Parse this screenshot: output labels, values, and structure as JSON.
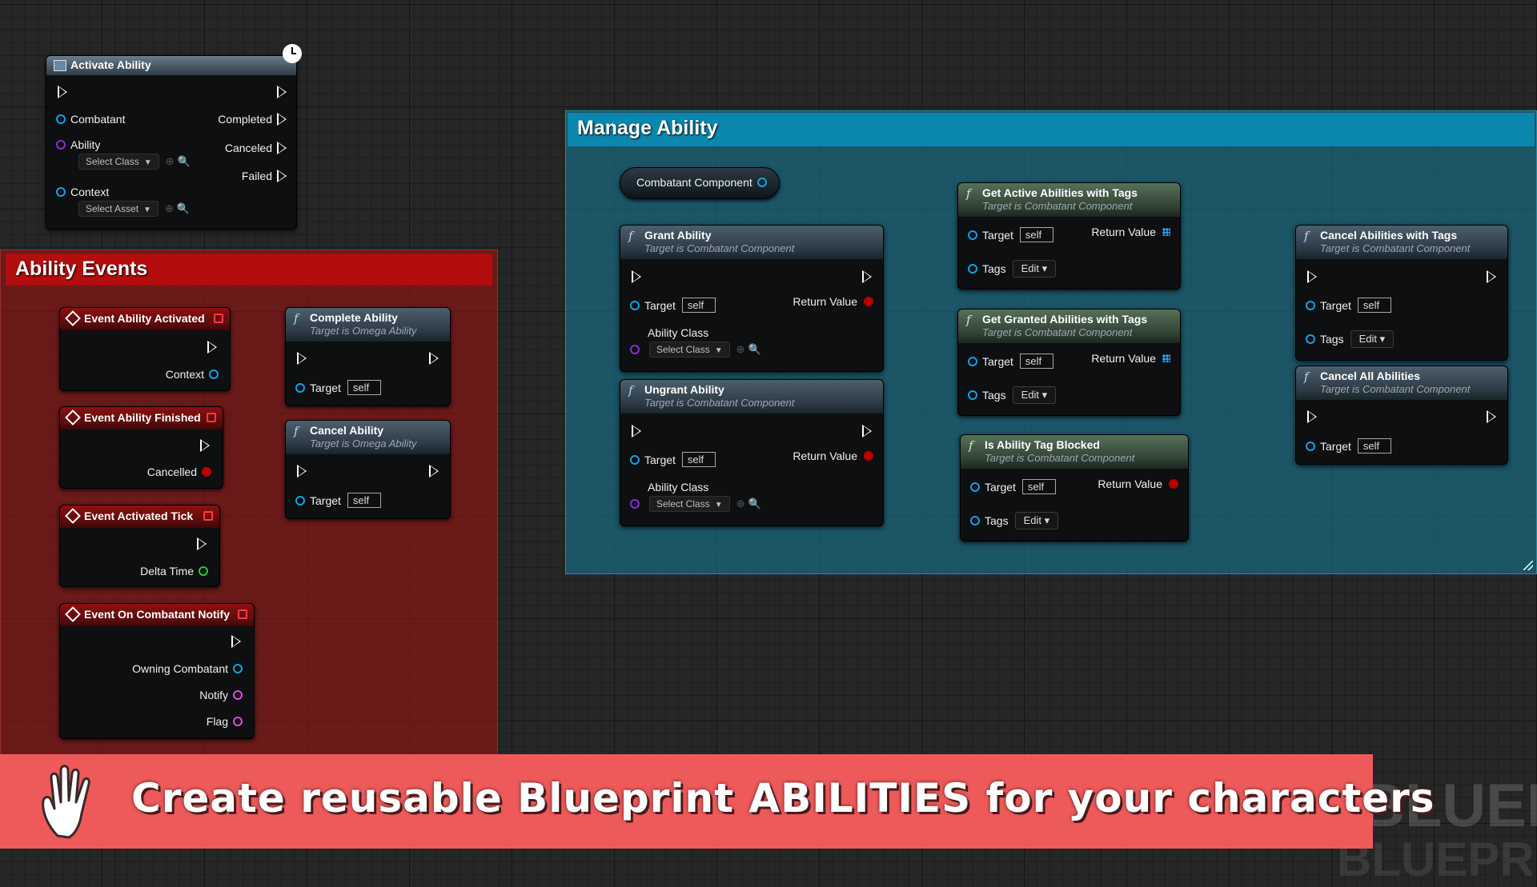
{
  "comments": {
    "ability_events": "Ability Events",
    "manage_ability": "Manage Ability"
  },
  "activate_ability": {
    "title": "Activate Ability",
    "combatant": "Combatant",
    "completed": "Completed",
    "ability": "Ability",
    "canceled": "Canceled",
    "select_class": "Select Class",
    "failed": "Failed",
    "context": "Context",
    "select_asset": "Select Asset"
  },
  "events": [
    {
      "title": "Event Ability Activated",
      "pins": [
        "Context"
      ]
    },
    {
      "title": "Event Ability Finished",
      "pins": [
        "Cancelled"
      ]
    },
    {
      "title": "Event Activated Tick",
      "pins": [
        "Delta Time"
      ]
    },
    {
      "title": "Event On Combatant Notify",
      "pins": [
        "Owning Combatant",
        "Notify",
        "Flag"
      ]
    }
  ],
  "omega_nodes": [
    {
      "title": "Complete Ability",
      "subtitle": "Target is Omega Ability",
      "target": "Target",
      "self": "self"
    },
    {
      "title": "Cancel Ability",
      "subtitle": "Target is Omega Ability",
      "target": "Target",
      "self": "self"
    }
  ],
  "combatant_component": "Combatant Component",
  "manage_nodes": {
    "grant": {
      "title": "Grant Ability",
      "subtitle": "Target is Combatant Component",
      "target": "Target",
      "self": "self",
      "return": "Return Value",
      "ability_class": "Ability Class",
      "select_class": "Select Class"
    },
    "ungrant": {
      "title": "Ungrant Ability",
      "subtitle": "Target is Combatant Component",
      "target": "Target",
      "self": "self",
      "return": "Return Value",
      "ability_class": "Ability Class",
      "select_class": "Select Class"
    },
    "get_active": {
      "title": "Get Active Abilities with Tags",
      "subtitle": "Target is Combatant Component",
      "target": "Target",
      "self": "self",
      "return": "Return Value",
      "tags": "Tags",
      "edit": "Edit"
    },
    "get_granted": {
      "title": "Get Granted Abilities with Tags",
      "subtitle": "Target is Combatant Component",
      "target": "Target",
      "self": "self",
      "return": "Return Value",
      "tags": "Tags",
      "edit": "Edit"
    },
    "is_blocked": {
      "title": "Is Ability Tag Blocked",
      "subtitle": "Target is Combatant Component",
      "target": "Target",
      "self": "self",
      "return": "Return Value",
      "tags": "Tags",
      "edit": "Edit"
    },
    "cancel_tags": {
      "title": "Cancel Abilities with Tags",
      "subtitle": "Target is Combatant Component",
      "target": "Target",
      "self": "self",
      "tags": "Tags",
      "edit": "Edit"
    },
    "cancel_all": {
      "title": "Cancel All Abilities",
      "subtitle": "Target is Combatant Component",
      "target": "Target",
      "self": "self"
    }
  },
  "banner": {
    "text": "Create reusable Blueprint ABILITIES for your characters",
    "icon": "hand-icon"
  },
  "watermark": {
    "line1": "BLUEPRINT",
    "line2": "BLUEPRINT"
  },
  "colors": {
    "event_header": "#8a1010",
    "comment_red": "#b30d0d",
    "comment_blue": "#0b86ad",
    "banner": "#ee5a5a",
    "object_pin": "#15a0e8",
    "class_pin": "#8a2cd6",
    "float_pin": "#1fcf2f",
    "bool_pin": "#b80000"
  }
}
